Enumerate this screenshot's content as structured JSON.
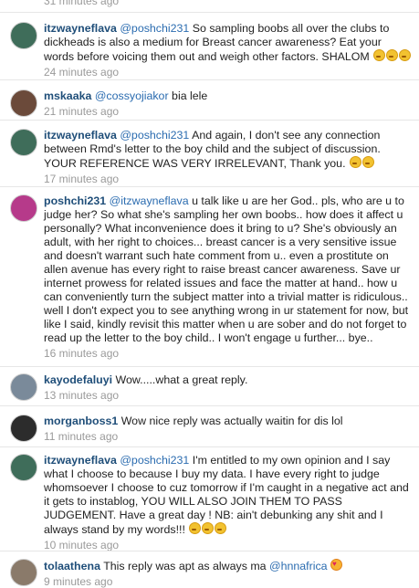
{
  "top_timestamp": "31 minutes ago",
  "comments": [
    {
      "username": "itzwayneflava",
      "mention": "@poshchi231",
      "text": "So sampling boobs all over the clubs to dickheads is also a medium for Breast cancer awareness? Eat your words before voicing them out and weigh other factors. SHALOM",
      "emojis": 3,
      "time": "24 minutes ago",
      "avatar_color": "#3f6d5a"
    },
    {
      "username": "mskaaka",
      "mention": "@cossyojiakor",
      "text": " bia lele",
      "emojis": 0,
      "time": "21 minutes ago",
      "avatar_color": "#6b4a3a"
    },
    {
      "username": "itzwayneflava",
      "mention": "@poshchi231",
      "text": "And again, I don't see any connection between Rmd's letter to the boy child and the subject of discussion. YOUR REFERENCE WAS VERY IRRELEVANT, Thank you.",
      "emojis": 2,
      "time": "17 minutes ago",
      "avatar_color": "#3f6d5a"
    },
    {
      "username": "poshchi231",
      "mention": "@itzwayneflava",
      "text": "u talk like u are her God.. pls, who are u to judge her? So what she's sampling her own boobs.. how does it affect u personally? What inconvenience does it bring to u? She's obviously an adult, with her right to choices... breast cancer is a very sensitive issue and doesn't warrant such hate comment from u.. even a prostitute on allen avenue has every right to raise breast cancer awareness. Save ur internet prowess for related issues and face the matter at hand.. how u can conveniently turn the subject matter into a trivial matter is ridiculous.. well I don't expect you to see anything wrong in ur statement for now, but like I said, kindly revisit this matter when u are sober and do not forget to read up the letter to the boy child.. I won't engage u further... bye..",
      "emojis": 0,
      "time": "16 minutes ago",
      "avatar_color": "#b63a8a"
    },
    {
      "username": "kayodefaluyi",
      "mention": "",
      "text": "Wow.....what a great reply.",
      "emojis": 0,
      "time": "13 minutes ago",
      "avatar_color": "#7a8a9a"
    },
    {
      "username": "morganboss1",
      "mention": "",
      "text": "Wow nice reply was actually waitin for dis lol",
      "emojis": 0,
      "time": "11 minutes ago",
      "avatar_color": "#2c2c2c"
    },
    {
      "username": "itzwayneflava",
      "mention": "@poshchi231",
      "text": "I'm entitled to my own opinion and I say what I choose to because I buy my data. I have every right to judge whomsoever I choose to cuz tomorrow if I'm caught in a negative act and it gets to instablog, YOU WILL ALSO JOIN THEM TO PASS JUDGEMENT. Have a great day ! NB: ain't debunking any shit and I always stand by my words!!!",
      "emojis": 3,
      "time": "10 minutes ago",
      "avatar_color": "#3f6d5a"
    },
    {
      "username": "tolaathena",
      "mention": "",
      "text": "This reply was apt as always ma ",
      "mention_after": "@hnnafrica",
      "emojis": 0,
      "heart_emoji": true,
      "time": "9 minutes ago",
      "avatar_color": "#8a7a6a"
    }
  ]
}
